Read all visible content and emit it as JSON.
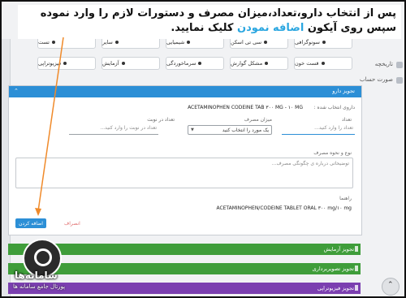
{
  "instruction": {
    "part1": "پس از انتخاب دارو،تعداد،میزان مصرف و دستورات لازم را وارد نموده سپس روی آیکون ",
    "highlight": "اضافه نمودن",
    "part2": " کلیک نمایید."
  },
  "right_sidebar": {
    "item1": "تاریخچه",
    "item2": "صورت حساب"
  },
  "chips_row1": [
    {
      "label": "سونوگرافی"
    },
    {
      "label": "سی تی اسکن"
    },
    {
      "label": "شیمیایی"
    },
    {
      "label": "سایر"
    },
    {
      "label": "تست"
    }
  ],
  "chips_row2": [
    {
      "label": "قست خون"
    },
    {
      "label": "مشکل گوارش"
    },
    {
      "label": "سرماخوردگی"
    },
    {
      "label": "آزمایش"
    },
    {
      "label": "فیزیوتراپی"
    }
  ],
  "drug_panel": {
    "title": "تجویز دارو",
    "selected_drug_label": "داروی انتخاب شده :",
    "selected_drug_value": "ACETAMINOPHEN CODEINE TAB ۳۰۰ MG - ۱۰ MG",
    "count_label": "تعداد",
    "count_placeholder": "تعداد را وارد کنید...",
    "usage_label": "میزان مصرف",
    "usage_select": "یک مورد را انتخاب کنید",
    "repeat_label": "تعداد در نوبت",
    "repeat_placeholder": "تعداد در نوبت را وارد کنید...",
    "notes_label": "نوع و نحوه مصرف",
    "notes_placeholder": "توضیحاتی درباره ی چگونگی مصرف...",
    "guide_label": "راهنما",
    "guide_value": "ACETAMINOPHEN/CODEINE TABLET ORAL ۳۰۰ mg/۱۰ mg",
    "add_button": "اضافه کردن",
    "cancel_button": "انصراف"
  },
  "sections": [
    {
      "title": "تجویز آزمایش",
      "color": "#3f9d3a"
    },
    {
      "title": "تجویز تصویربرداری",
      "color": "#3f9d3a"
    },
    {
      "title": "تجویز فیزیوتراپی",
      "color": "#7b3fb0"
    }
  ],
  "logo": {
    "name": "سامانه‌ها",
    "subtitle": "پورتال جامع سامانه ها"
  }
}
